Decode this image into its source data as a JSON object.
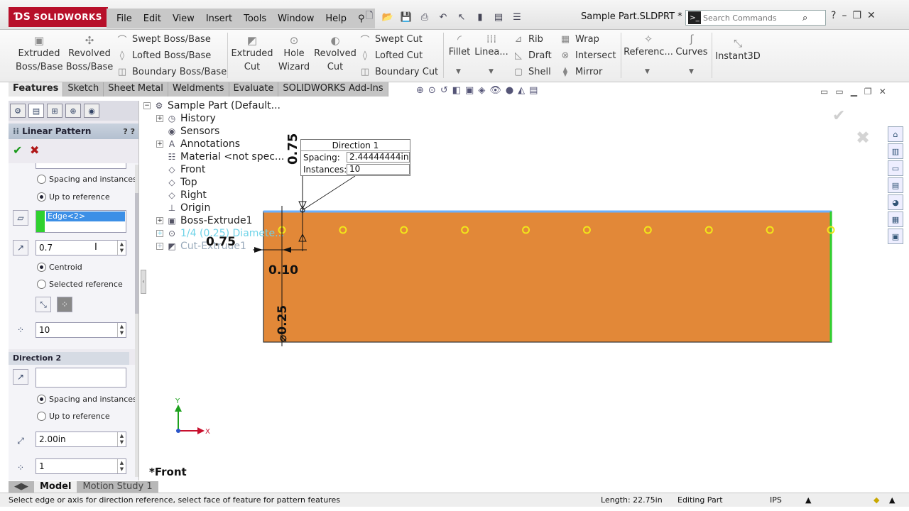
{
  "app": {
    "logo": "SOLIDWORKS",
    "doc_title": "Sample Part.SLDPRT *"
  },
  "menu": [
    "File",
    "Edit",
    "View",
    "Insert",
    "Tools",
    "Window",
    "Help"
  ],
  "search": {
    "placeholder": "Search Commands"
  },
  "ribbon": {
    "extruded_boss": "Extruded\nBoss/Base",
    "revolved_boss": "Revolved\nBoss/Base",
    "swept_boss": "Swept Boss/Base",
    "lofted_boss": "Lofted Boss/Base",
    "boundary_boss": "Boundary Boss/Base",
    "extruded_cut": "Extruded\nCut",
    "hole_wizard": "Hole\nWizard",
    "revolved_cut": "Revolved\nCut",
    "swept_cut": "Swept Cut",
    "lofted_cut": "Lofted Cut",
    "boundary_cut": "Boundary Cut",
    "fillet": "Fillet",
    "linear": "Linea...",
    "rib": "Rib",
    "draft": "Draft",
    "shell": "Shell",
    "wrap": "Wrap",
    "intersect": "Intersect",
    "mirror": "Mirror",
    "reference": "Referenc...",
    "curves": "Curves",
    "instant3d": "Instant3D"
  },
  "tabs": [
    "Features",
    "Sketch",
    "Sheet Metal",
    "Weldments",
    "Evaluate",
    "SOLIDWORKS Add-Ins"
  ],
  "property_manager": {
    "title": "Linear Pattern",
    "dir1": {
      "option_spacing": "Spacing and instances",
      "option_upto": "Up to reference",
      "selected": "up_to_reference",
      "edge": "Edge<2>",
      "offset": "0.7",
      "centroid": "Centroid",
      "selected_ref": "Selected reference",
      "instances": "10"
    },
    "dir2": {
      "title": "Direction 2",
      "option_spacing": "Spacing and instances",
      "option_upto": "Up to reference",
      "selected": "spacing",
      "spacing": "2.00in",
      "instances": "1"
    }
  },
  "tree": [
    "Sample Part  (Default...",
    "History",
    "Sensors",
    "Annotations",
    "Material <not spec...",
    "Front",
    "Top",
    "Right",
    "Origin",
    "Boss-Extrude1",
    "1/4 (0.25) Diamete...",
    "Cut-Extrude1"
  ],
  "callout": {
    "title": "Direction 1",
    "spacing_label": "Spacing:",
    "spacing_value": "2.44444444in",
    "instances_label": "Instances:",
    "instances_value": "10"
  },
  "dimensions": {
    "vertical_top": "0.75",
    "horizontal": "0.75",
    "offset": "0.10",
    "diameter": "⌀0.25"
  },
  "pattern": {
    "instance_count": 10
  },
  "view_label": "*Front",
  "triad": {
    "x": "X",
    "y": "Y"
  },
  "bottom_tabs": [
    "Model",
    "Motion Study 1"
  ],
  "status": {
    "message": "Select edge or axis for direction reference, select face of feature for pattern features",
    "length": "Length: 22.75in",
    "mode": "Editing Part",
    "units": "IPS"
  },
  "colors": {
    "part": "#e28838",
    "hole": "#f2e61a",
    "edge_top": "#6ab0ff",
    "edge_right": "#2fd12f",
    "accent": "#b7102a"
  }
}
